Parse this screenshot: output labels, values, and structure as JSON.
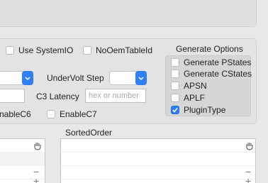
{
  "options_row1": {
    "use_systemio": {
      "label": "Use SystemIO",
      "checked": false
    },
    "no_oem_table_id": {
      "label": "NoOemTableId",
      "checked": false
    }
  },
  "undervolt": {
    "label": "UnderVolt Step",
    "value": ""
  },
  "c3_latency": {
    "label": "C3 Latency",
    "placeholder": "hex or number"
  },
  "enable_c6": {
    "label": "nableC6",
    "checked": false
  },
  "enable_c7": {
    "label": "EnableC7",
    "checked": false
  },
  "generate_options": {
    "title": "Generate Options",
    "items": [
      {
        "label": "Generate PStates",
        "checked": false
      },
      {
        "label": "Generate CStates",
        "checked": false
      },
      {
        "label": "APSN",
        "checked": false
      },
      {
        "label": "APLF",
        "checked": false
      },
      {
        "label": "PluginType",
        "checked": true
      }
    ]
  },
  "sorted_order": {
    "label": "SortedOrder"
  },
  "list_controls": {
    "add": "+",
    "remove": "−"
  },
  "icons": {
    "check": "check-icon",
    "popup": "chevron-updown-icon",
    "drag": "drag-hand-icon"
  }
}
